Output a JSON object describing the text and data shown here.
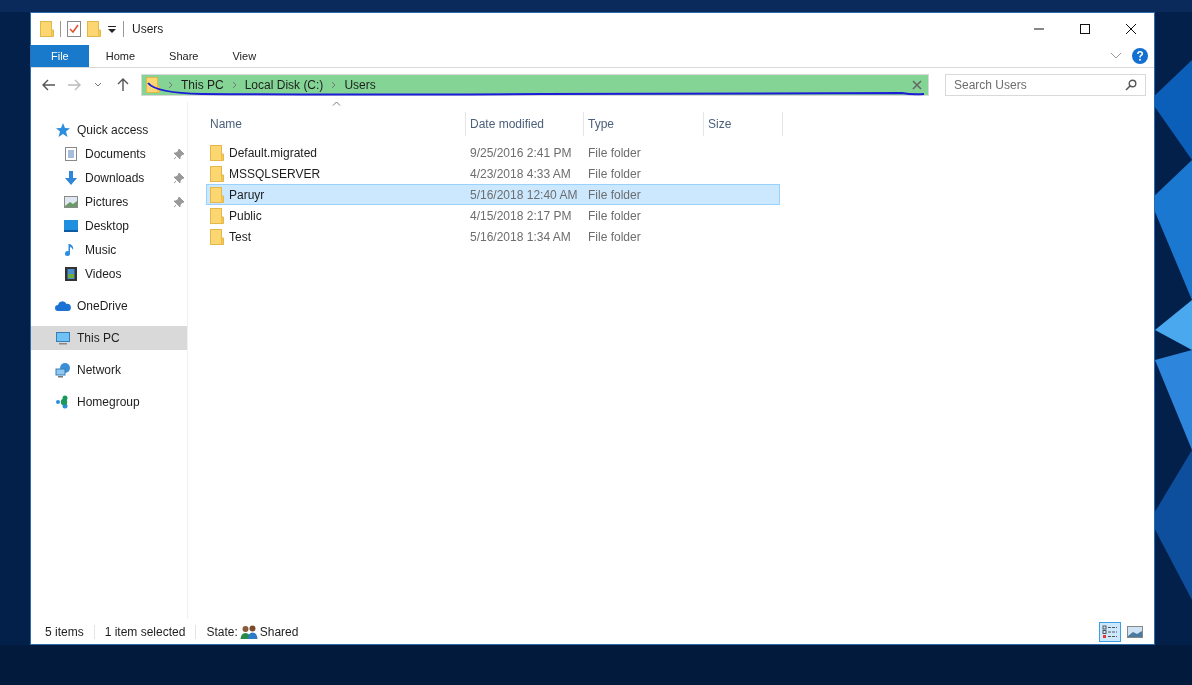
{
  "window": {
    "title": "Users"
  },
  "ribbon_tabs": [
    {
      "label": "File",
      "kind": "file",
      "selected": false
    },
    {
      "label": "Home",
      "kind": "tab",
      "selected": false
    },
    {
      "label": "Share",
      "kind": "tab",
      "selected": false
    },
    {
      "label": "View",
      "kind": "tab",
      "selected": false
    }
  ],
  "address_bar": {
    "path": [
      "This PC",
      "Local Disk (C:)",
      "Users"
    ],
    "highlighted": true
  },
  "search": {
    "placeholder": "Search Users"
  },
  "sidebar": {
    "items": [
      {
        "label": "Quick access",
        "kind": "star",
        "selected": false,
        "children": [
          {
            "label": "Documents",
            "kind": "document",
            "pinned": true,
            "selected": false
          },
          {
            "label": "Downloads",
            "kind": "download",
            "pinned": true,
            "selected": false
          },
          {
            "label": "Pictures",
            "kind": "pictures",
            "pinned": true,
            "selected": false
          },
          {
            "label": "Desktop",
            "kind": "desktop",
            "pinned": false,
            "selected": false
          },
          {
            "label": "Music",
            "kind": "music",
            "pinned": false,
            "selected": false
          },
          {
            "label": "Videos",
            "kind": "videos",
            "pinned": false,
            "selected": false
          }
        ]
      },
      {
        "label": "OneDrive",
        "kind": "cloud",
        "selected": false
      },
      {
        "label": "This PC",
        "kind": "pc",
        "selected": true
      },
      {
        "label": "Network",
        "kind": "network",
        "selected": false
      },
      {
        "label": "Homegroup",
        "kind": "homegroup",
        "selected": false
      }
    ]
  },
  "table": {
    "columns": [
      {
        "label": "Name",
        "sorted": true
      },
      {
        "label": "Date modified",
        "sorted": false
      },
      {
        "label": "Type",
        "sorted": false
      },
      {
        "label": "Size",
        "sorted": false
      }
    ],
    "rows": [
      {
        "name": "Default.migrated",
        "date_modified": "9/25/2016 2:41 PM",
        "type": "File folder",
        "selected": false
      },
      {
        "name": "MSSQLSERVER",
        "date_modified": "4/23/2018 4:33 AM",
        "type": "File folder",
        "selected": false
      },
      {
        "name": "Paruyr",
        "date_modified": "5/16/2018 12:40 AM",
        "type": "File folder",
        "selected": true
      },
      {
        "name": "Public",
        "date_modified": "4/15/2018 2:17 PM",
        "type": "File folder",
        "selected": false
      },
      {
        "name": "Test",
        "date_modified": "5/16/2018 1:34 AM",
        "type": "File folder",
        "selected": false
      }
    ]
  },
  "status_bar": {
    "item_count": "5 items",
    "selection": "1 item selected",
    "state_label": "State:",
    "state_value": "Shared"
  },
  "view_buttons": [
    {
      "kind": "details",
      "selected": true
    },
    {
      "kind": "large_icons",
      "selected": false
    }
  ]
}
